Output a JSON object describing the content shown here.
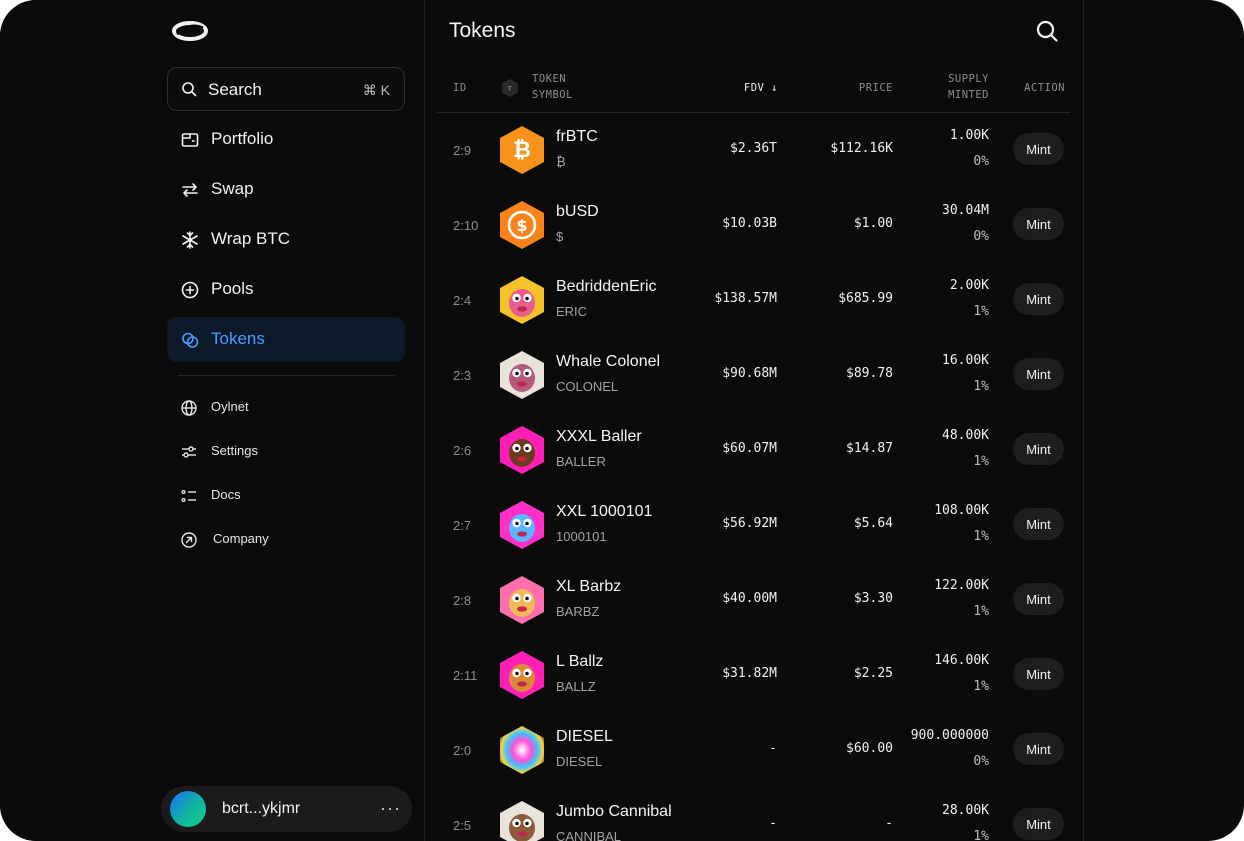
{
  "sidebar": {
    "search": {
      "label": "Search",
      "shortcut": "⌘ K"
    },
    "nav": [
      {
        "id": "portfolio",
        "label": "Portfolio",
        "icon": "wallet-icon",
        "active": false
      },
      {
        "id": "swap",
        "label": "Swap",
        "icon": "swap-arrows-icon",
        "active": false
      },
      {
        "id": "wrap",
        "label": "Wrap BTC",
        "icon": "snowflake-icon",
        "active": false
      },
      {
        "id": "pools",
        "label": "Pools",
        "icon": "plus-circle-icon",
        "active": false
      },
      {
        "id": "tokens",
        "label": "Tokens",
        "icon": "tokens-icon",
        "active": true
      }
    ],
    "secondary": [
      {
        "id": "network",
        "label": "Oylnet",
        "icon": "globe-icon"
      },
      {
        "id": "settings",
        "label": "Settings",
        "icon": "sliders-icon"
      },
      {
        "id": "docs",
        "label": "Docs",
        "icon": "list-icon"
      },
      {
        "id": "company",
        "label": "Company",
        "icon": "external-arrow-icon"
      }
    ],
    "account": {
      "address": "bcrt...ykjmr",
      "more": "···"
    }
  },
  "main": {
    "title": "Tokens",
    "columns": {
      "id": "ID",
      "badge": "T",
      "token_line1": "TOKEN",
      "token_line2": "SYMBOL",
      "fdv": "FDV ↓",
      "price": "PRICE",
      "supply_line1": "SUPPLY",
      "supply_line2": "MINTED",
      "action": "ACTION"
    },
    "rows": [
      {
        "id": "2:9",
        "name": "frBTC",
        "symbol": "₿",
        "fdv": "$2.36T",
        "price": "$112.16K",
        "supply": "1.00K",
        "minted": "0%",
        "action": "Mint",
        "icon": "bitcoin-icon"
      },
      {
        "id": "2:10",
        "name": "bUSD",
        "symbol": "$",
        "fdv": "$10.03B",
        "price": "$1.00",
        "supply": "30.04M",
        "minted": "0%",
        "action": "Mint",
        "icon": "dollar-icon"
      },
      {
        "id": "2:4",
        "name": "BedriddenEric",
        "symbol": "ERIC",
        "fdv": "$138.57M",
        "price": "$685.99",
        "supply": "2.00K",
        "minted": "1%",
        "action": "Mint",
        "icon": "avatar-eric-icon"
      },
      {
        "id": "2:3",
        "name": "Whale Colonel",
        "symbol": "COLONEL",
        "fdv": "$90.68M",
        "price": "$89.78",
        "supply": "16.00K",
        "minted": "1%",
        "action": "Mint",
        "icon": "avatar-colonel-icon"
      },
      {
        "id": "2:6",
        "name": "XXXL Baller",
        "symbol": "BALLER",
        "fdv": "$60.07M",
        "price": "$14.87",
        "supply": "48.00K",
        "minted": "1%",
        "action": "Mint",
        "icon": "avatar-baller-icon"
      },
      {
        "id": "2:7",
        "name": "XXL 1000101",
        "symbol": "1000101",
        "fdv": "$56.92M",
        "price": "$5.64",
        "supply": "108.00K",
        "minted": "1%",
        "action": "Mint",
        "icon": "avatar-1000101-icon"
      },
      {
        "id": "2:8",
        "name": "XL Barbz",
        "symbol": "BARBZ",
        "fdv": "$40.00M",
        "price": "$3.30",
        "supply": "122.00K",
        "minted": "1%",
        "action": "Mint",
        "icon": "avatar-barbz-icon"
      },
      {
        "id": "2:11",
        "name": "L Ballz",
        "symbol": "BALLZ",
        "fdv": "$31.82M",
        "price": "$2.25",
        "supply": "146.00K",
        "minted": "1%",
        "action": "Mint",
        "icon": "avatar-ballz-icon"
      },
      {
        "id": "2:0",
        "name": "DIESEL",
        "symbol": "DIESEL",
        "fdv": "-",
        "price": "$60.00",
        "supply": "900.000000",
        "minted": "0%",
        "action": "Mint",
        "icon": "diesel-icon"
      },
      {
        "id": "2:5",
        "name": "Jumbo Cannibal",
        "symbol": "CANNIBAL",
        "fdv": "-",
        "price": "-",
        "supply": "28.00K",
        "minted": "1%",
        "action": "Mint",
        "icon": "avatar-cannibal-icon"
      }
    ]
  }
}
